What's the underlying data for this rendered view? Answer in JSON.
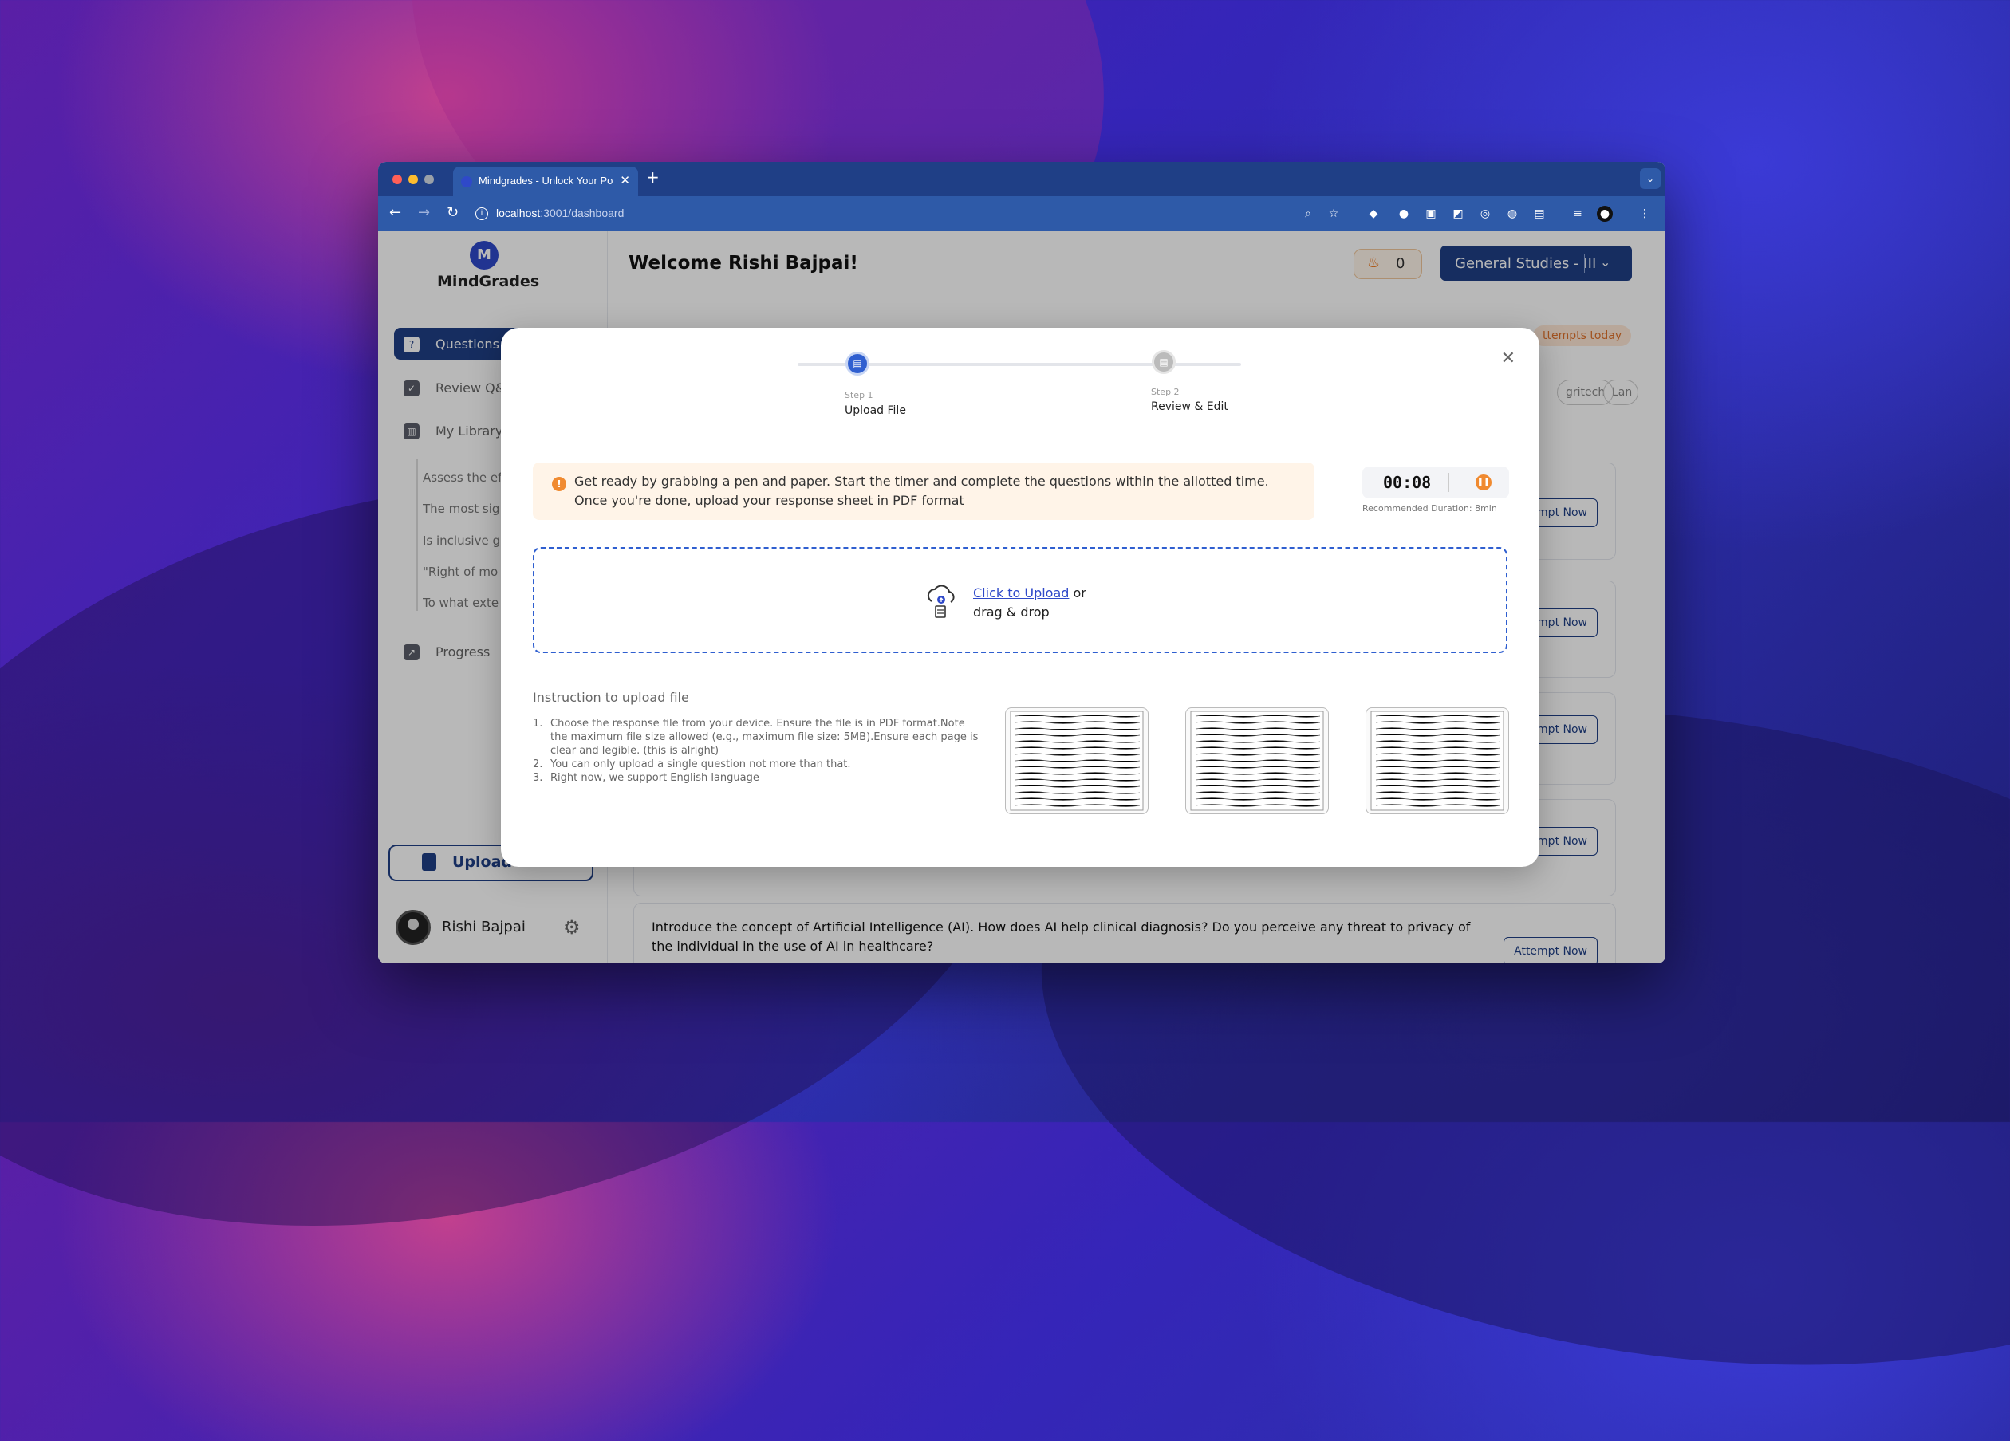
{
  "browser": {
    "tab_title": "Mindgrades - Unlock Your Pot",
    "url_host": "localhost",
    "url_path": ":3001/dashboard"
  },
  "sidebar": {
    "logo": "MindGrades",
    "nav": [
      {
        "label": "Questions"
      },
      {
        "label": "Review Q&A"
      },
      {
        "label": "My Library"
      },
      {
        "label": "Progress"
      }
    ],
    "library_items": [
      "Assess the ef",
      "The most sig",
      "Is inclusive g",
      "\"Right of mo",
      "To what exte"
    ],
    "upload_label": "Upload",
    "user_name": "Rishi Bajpai"
  },
  "header": {
    "welcome": "Welcome Rishi Bajpai!",
    "streak": "0",
    "subject": "General Studies - III"
  },
  "main": {
    "attempts_badge": "ttempts today",
    "chips": [
      "gritech",
      "Lan"
    ],
    "attempt_label": "mpt Now",
    "attempt_full_label": "Attempt Now",
    "last_question": "Introduce the concept of Artificial Intelligence (AI). How does AI help clinical diagnosis? Do you perceive any threat to privacy of the individual in the use of AI in healthcare?"
  },
  "modal": {
    "step1_tag": "Step 1",
    "step1_label": "Upload File",
    "step2_tag": "Step 2",
    "step2_label": "Review & Edit",
    "info": "Get ready by grabbing a pen and paper. Start the timer and complete the questions within the allotted time. Once you're done, upload your response sheet in PDF format",
    "timer": "00:08",
    "recommended": "Recommended Duration: 8min",
    "click_upload": "Click to Upload",
    "drag_drop": " or drag & drop",
    "instr_title": "Instruction to upload file",
    "instructions": [
      "Choose the response file from your device. Ensure the file is in PDF format.Note the maximum file size allowed (e.g., maximum file size: 5MB).Ensure each page is clear and legible. (this is alright)",
      "You can only upload a single question not more than that.",
      "Right now, we support English language"
    ]
  }
}
